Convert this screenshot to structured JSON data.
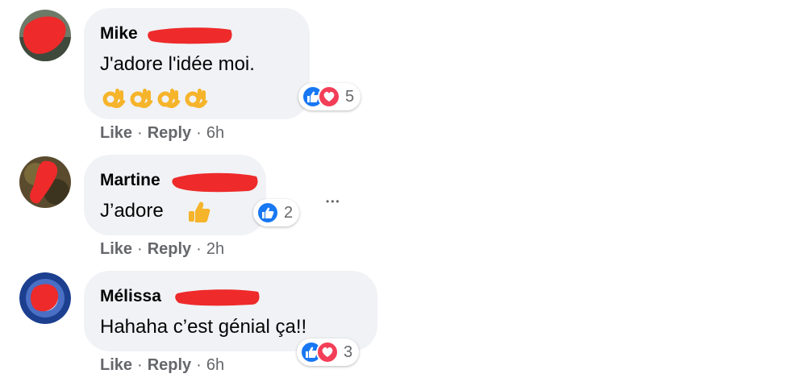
{
  "comments": [
    {
      "name": "Mike",
      "text": "J'adore l'idée moi.",
      "emoji_count": 4,
      "reaction_count": "5",
      "reactions": [
        "like",
        "love"
      ],
      "actions": {
        "like": "Like",
        "reply": "Reply",
        "time": "6h"
      }
    },
    {
      "name": "Martine",
      "text": "J’adore",
      "reaction_count": "2",
      "reactions": [
        "like"
      ],
      "actions": {
        "like": "Like",
        "reply": "Reply",
        "time": "2h"
      }
    },
    {
      "name": "Mélissa",
      "text": "Hahaha c’est génial ça!!",
      "reaction_count": "3",
      "reactions": [
        "like",
        "love"
      ],
      "actions": {
        "like": "Like",
        "reply": "Reply",
        "time": "6h"
      }
    }
  ],
  "ui": {
    "more_label": "•••",
    "separator": "·"
  },
  "colors": {
    "bubble": "#f0f2f5",
    "name": "#050505",
    "meta": "#65676b",
    "like": "#1877f2",
    "love": "#f33e58",
    "redaction": "#ee2a2a"
  }
}
